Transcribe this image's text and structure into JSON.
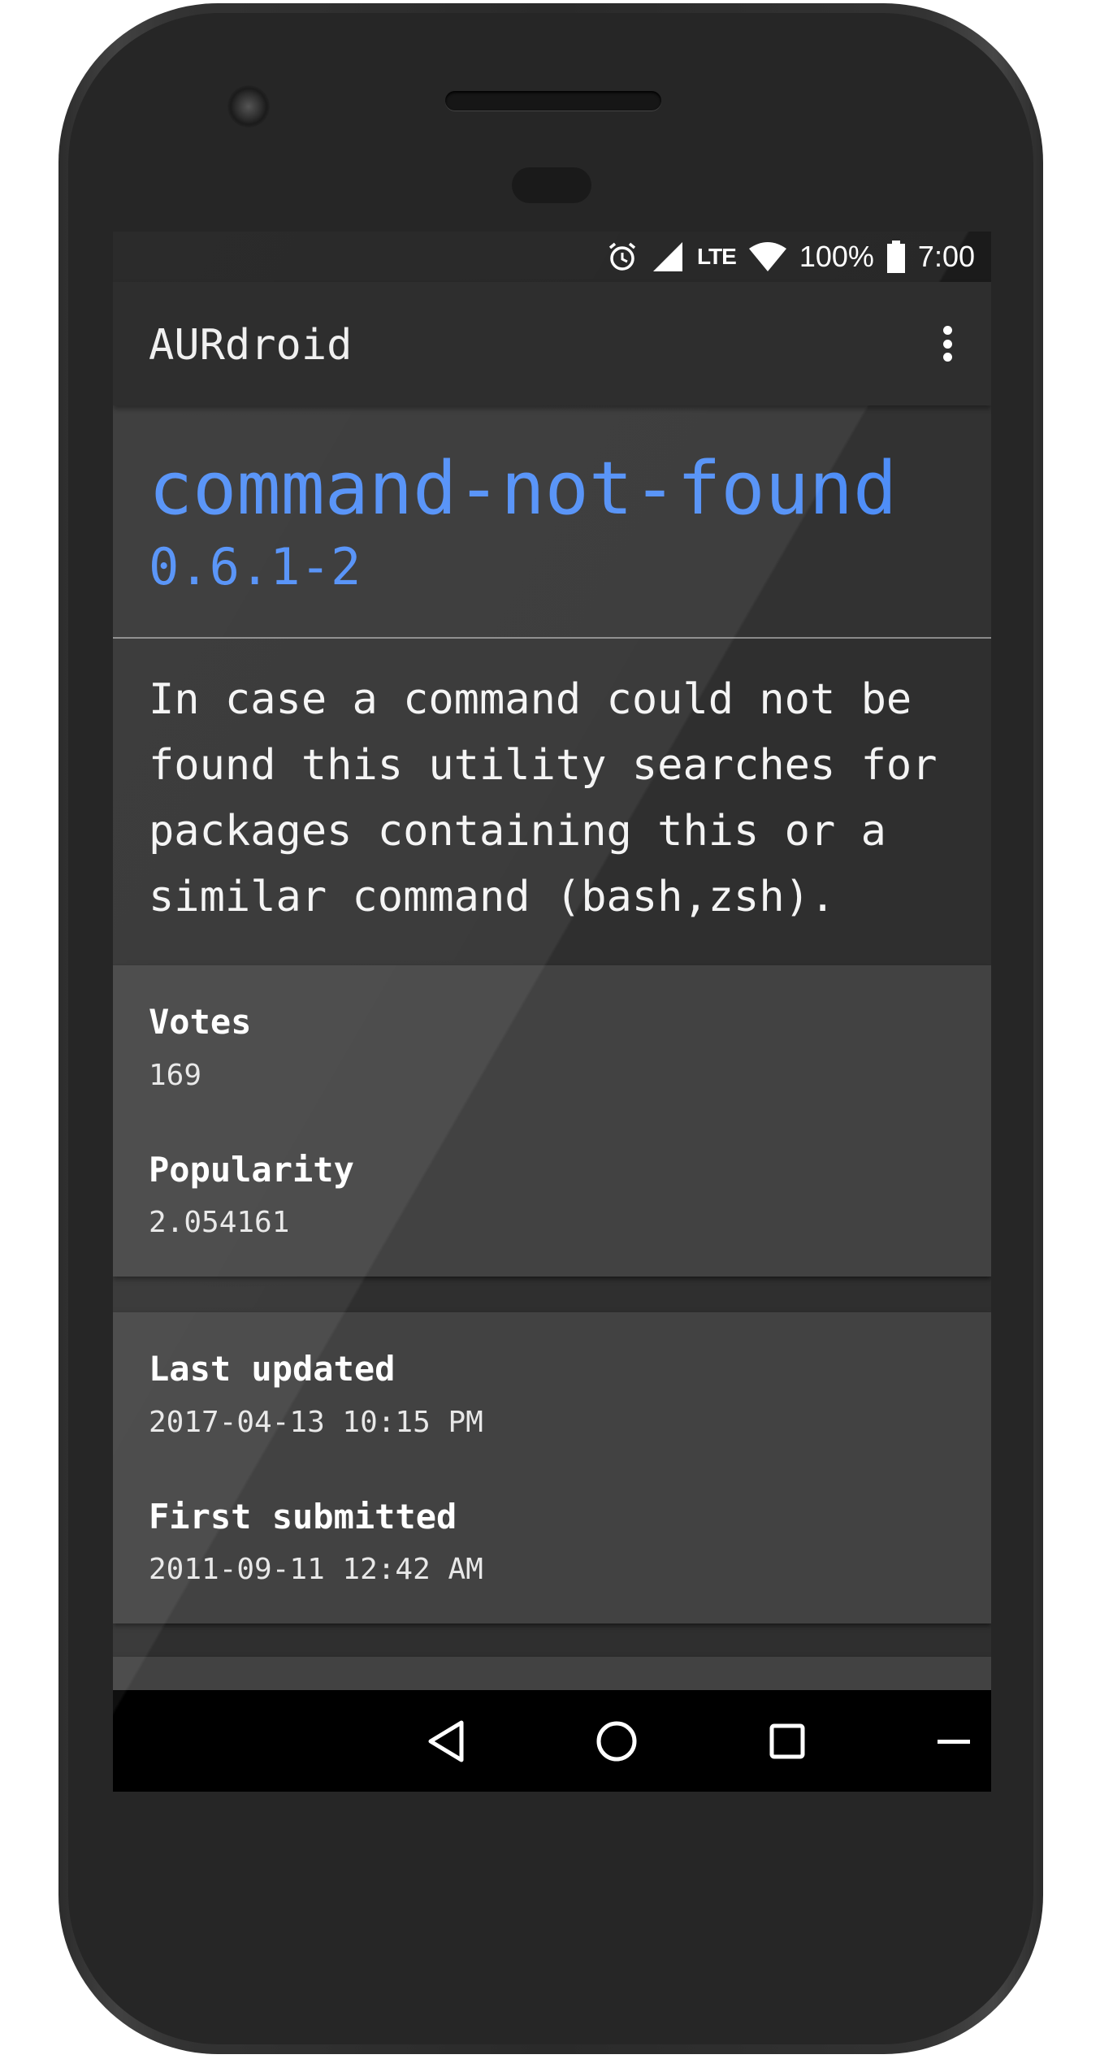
{
  "status_bar": {
    "battery": "100%",
    "time": "7:00",
    "network": "LTE",
    "icons": [
      "alarm-icon",
      "cell-signal-icon",
      "wifi-icon",
      "battery-icon"
    ]
  },
  "app_bar": {
    "title": "AURdroid",
    "menu_icon": "more-vert-icon"
  },
  "package": {
    "name": "command-not-found",
    "version": "0.6.1-2",
    "description_lines": [
      "In case a command could not be",
      "found this utility searches for",
      "packages containing this or a",
      "similar command (bash,zsh)."
    ]
  },
  "stats_card": {
    "votes_label": "Votes",
    "votes_value": "169",
    "popularity_label": "Popularity",
    "popularity_value": "2.054161"
  },
  "dates_card": {
    "last_updated_label": "Last updated",
    "last_updated_value": "2017-04-13 10:15 PM",
    "first_submitted_label": "First submitted",
    "first_submitted_value": "2011-09-11 12:42 AM"
  },
  "nav_bar": {
    "icons": [
      "back-icon",
      "home-icon",
      "recents-icon",
      "keyboard-hide-icon"
    ]
  },
  "colors": {
    "accent": "#4f8ef7",
    "background": "#2f2f2f",
    "card": "#424242"
  }
}
